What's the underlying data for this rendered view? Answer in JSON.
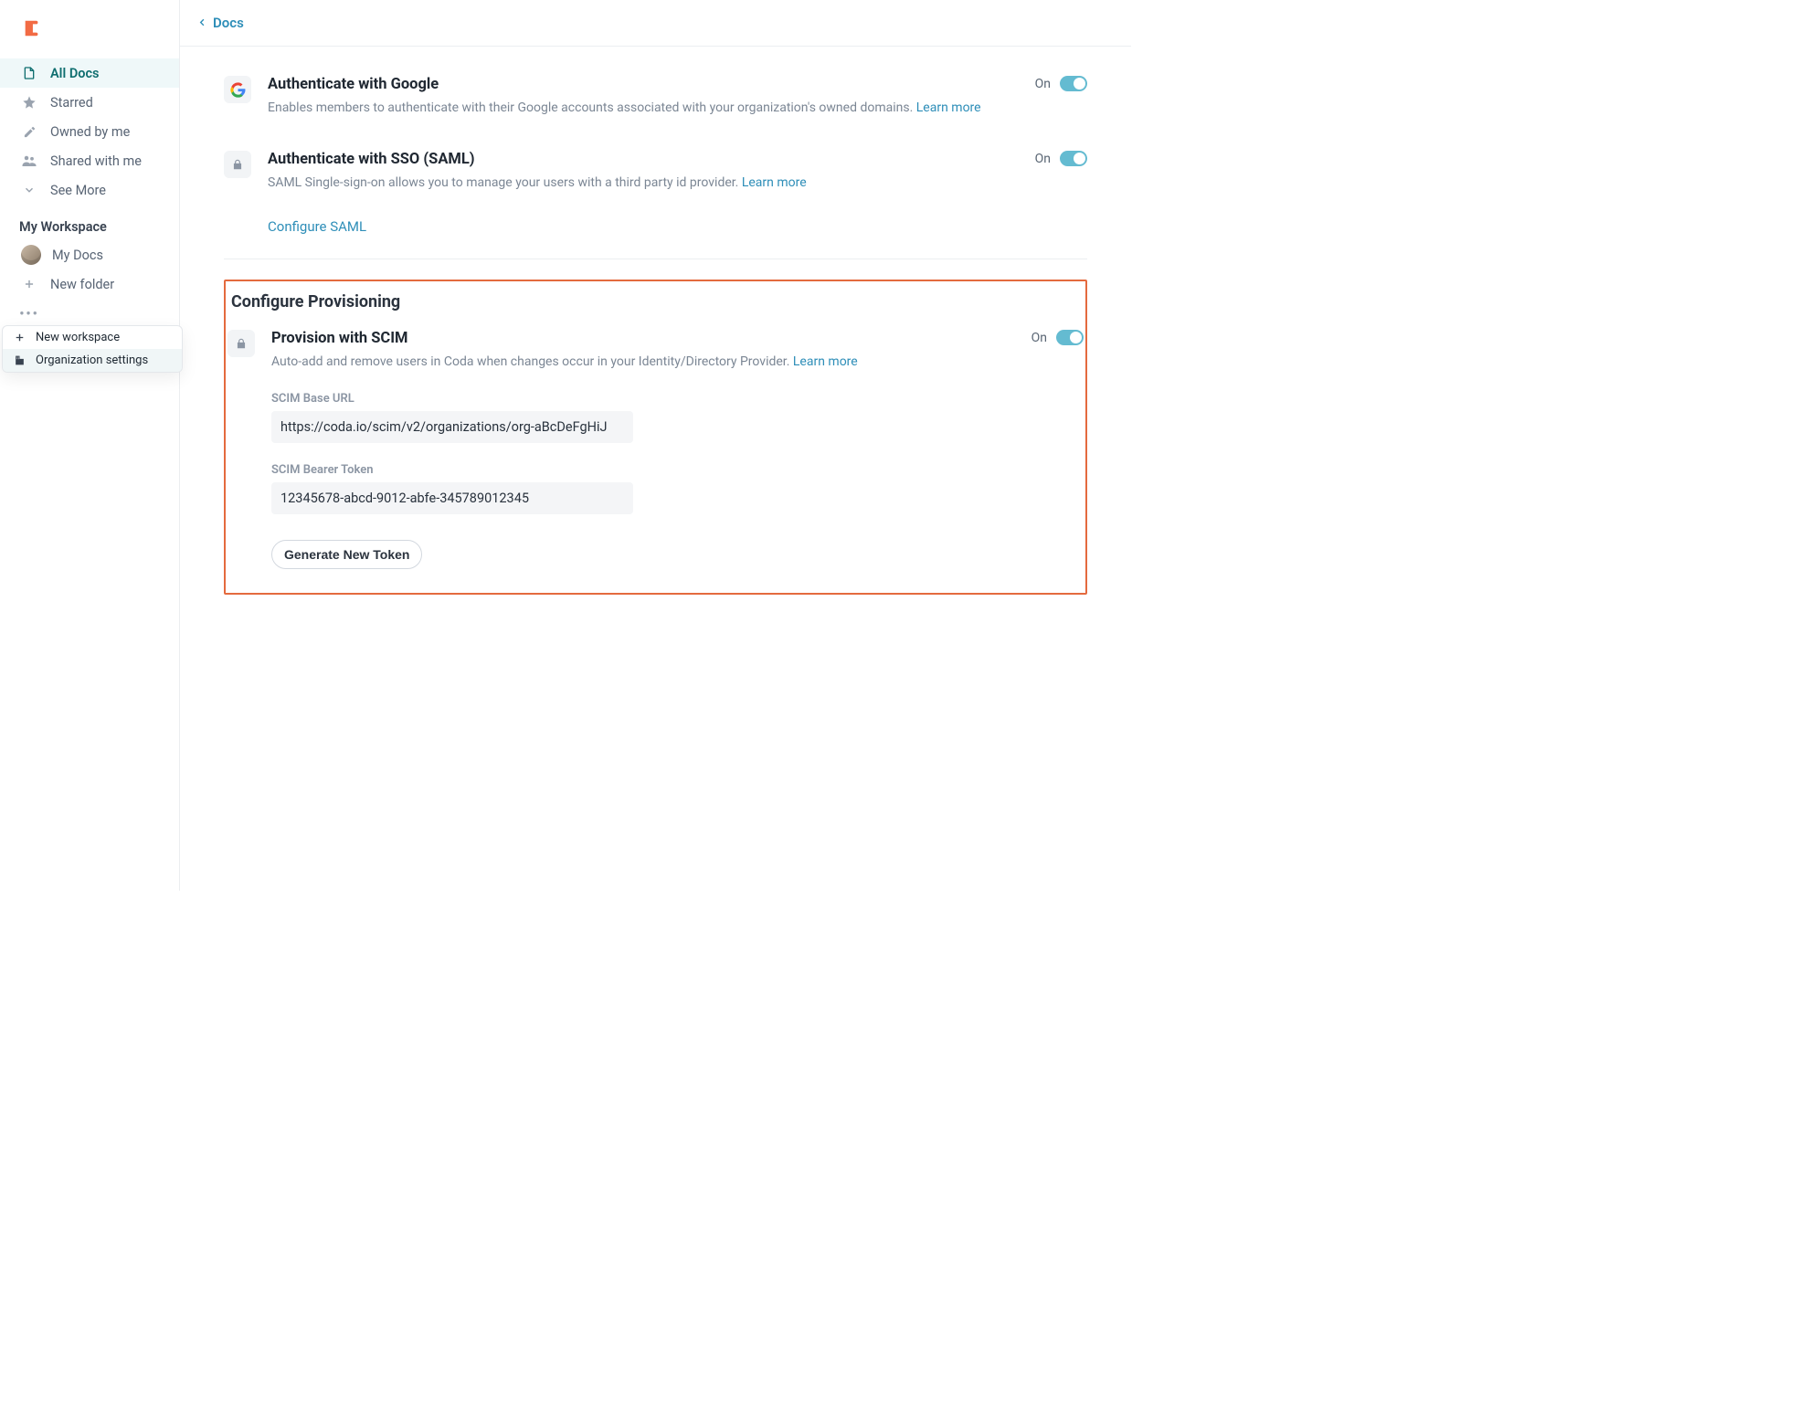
{
  "sidebar": {
    "nav": [
      {
        "label": "All Docs",
        "icon": "doc-icon",
        "active": true
      },
      {
        "label": "Starred",
        "icon": "star-icon",
        "active": false
      },
      {
        "label": "Owned by me",
        "icon": "pencil-icon",
        "active": false
      },
      {
        "label": "Shared with me",
        "icon": "people-icon",
        "active": false
      },
      {
        "label": "See More",
        "icon": "chevron-down-icon",
        "active": false
      }
    ],
    "workspace_heading": "My Workspace",
    "workspace": [
      {
        "label": "My Docs",
        "icon": "avatar"
      },
      {
        "label": "New folder",
        "icon": "plus-icon"
      }
    ],
    "flyout": [
      {
        "label": "New workspace",
        "icon": "plus-icon"
      },
      {
        "label": "Organization settings",
        "icon": "building-icon",
        "selected": true
      }
    ]
  },
  "topbar": {
    "back_label": "Docs"
  },
  "settings": {
    "google": {
      "title": "Authenticate with Google",
      "desc": "Enables members to authenticate with their Google accounts associated with your organization's owned domains.",
      "learn_more": "Learn more",
      "state_label": "On"
    },
    "sso": {
      "title": "Authenticate with SSO (SAML)",
      "desc": "SAML Single-sign-on allows you to manage your users with a third party id provider.",
      "learn_more": "Learn more",
      "configure": "Configure SAML",
      "state_label": "On"
    }
  },
  "provisioning": {
    "section_title": "Configure Provisioning",
    "scim": {
      "title": "Provision with SCIM",
      "desc": "Auto-add and remove users in Coda when changes occur in your Identity/Directory Provider.",
      "learn_more": "Learn more",
      "state_label": "On",
      "base_url_label": "SCIM Base URL",
      "base_url": "https://coda.io/scim/v2/organizations/org-aBcDeFgHiJ",
      "token_label": "SCIM Bearer Token",
      "token": "12345678-abcd-9012-abfe-345789012345",
      "generate_button": "Generate New Token"
    }
  }
}
